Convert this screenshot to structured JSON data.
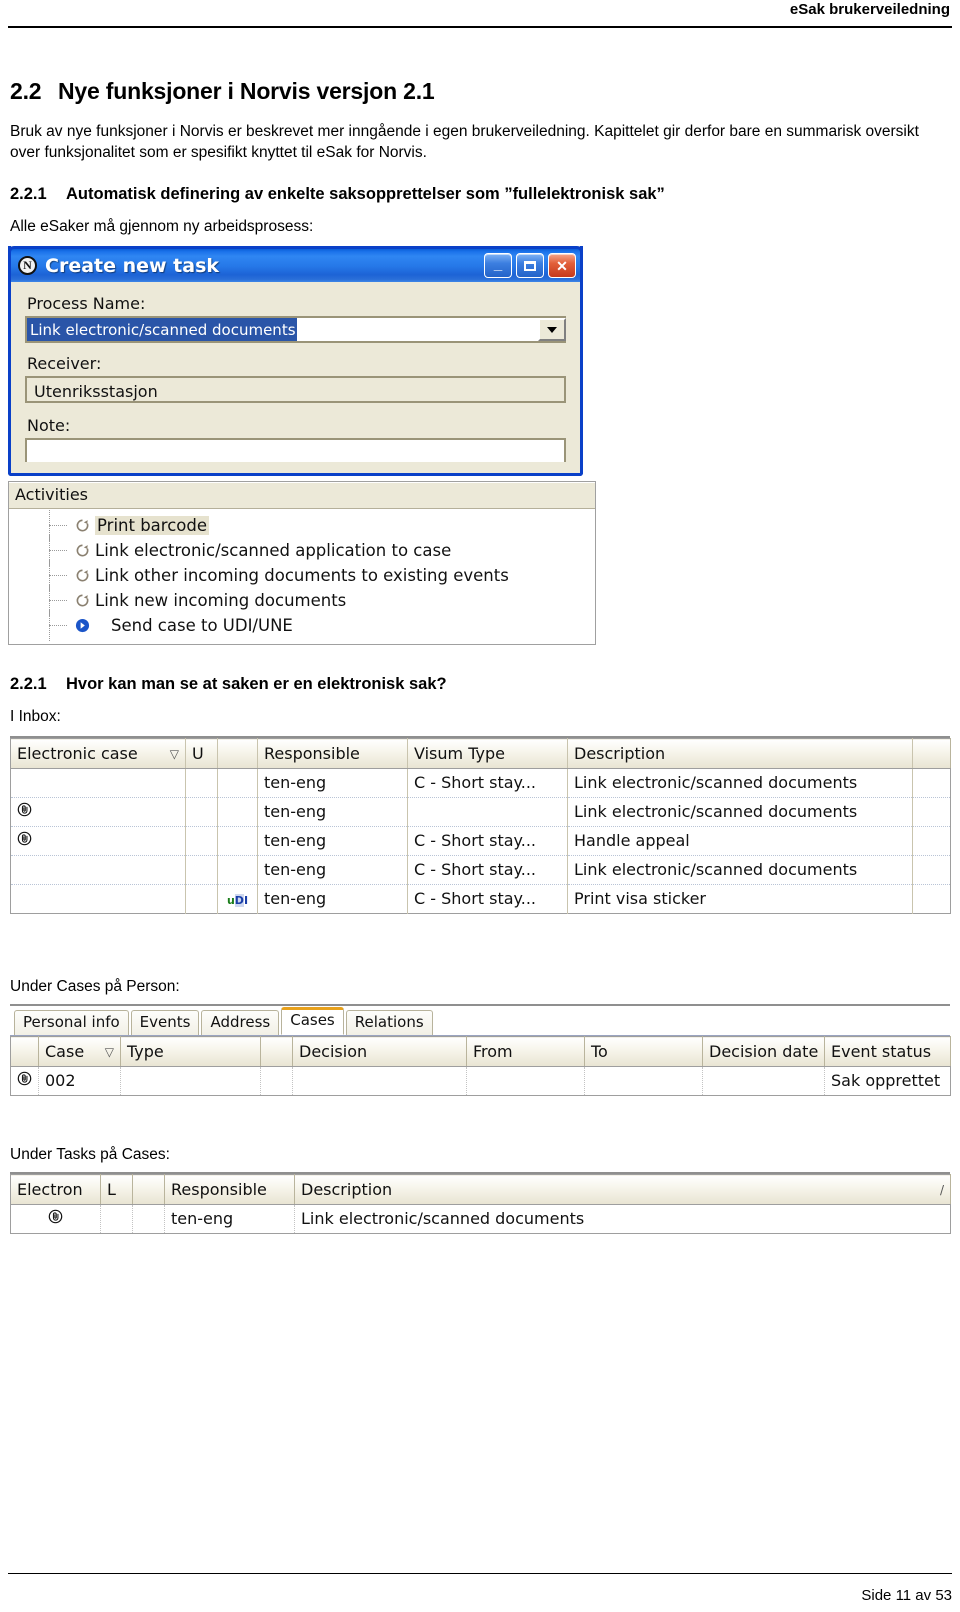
{
  "header": {
    "title": "eSak brukerveiledning"
  },
  "footer": {
    "page_label": "Side 11 av 53"
  },
  "section": {
    "number": "2.2",
    "title": "Nye funksjoner i Norvis versjon 2.1",
    "paragraph": "Bruk av nye funksjoner i Norvis er beskrevet mer inngående i egen brukerveiledning. Kapittelet gir derfor bare en summarisk oversikt over funksjonalitet som er spesifikt knyttet til eSak for Norvis."
  },
  "subsection_1": {
    "number": "2.2.1",
    "title": "Automatisk definering av enkelte saksopprettelser som ”fullelektronisk sak”",
    "lead": "Alle eSaker må gjennom ny arbeidsprosess:"
  },
  "dialog": {
    "title": "Create new task",
    "app_icon_letter": "N",
    "buttons": {
      "minimize": "_",
      "maximize": "□",
      "close": "✕"
    },
    "fields": {
      "process_name_label": "Process Name:",
      "process_name_value": "Link electronic/scanned documents",
      "receiver_label": "Receiver:",
      "receiver_value": "Utenriksstasjon",
      "note_label": "Note:",
      "note_value": ""
    }
  },
  "activities": {
    "header": "Activities",
    "items": [
      {
        "label": "Print barcode",
        "icon": "refresh-icon",
        "highlighted": true
      },
      {
        "label": "Link electronic/scanned application to case",
        "icon": "refresh-icon",
        "highlighted": false
      },
      {
        "label": "Link other incoming documents to existing events",
        "icon": "refresh-icon",
        "highlighted": false
      },
      {
        "label": "Link new incoming documents",
        "icon": "refresh-icon",
        "highlighted": false
      },
      {
        "label": "Send case to UDI/UNE",
        "icon": "blue-arrow-icon",
        "highlighted": false
      }
    ]
  },
  "subsection_2": {
    "number": "2.2.1",
    "title": "Hvor kan man se at saken er en elektronisk sak?",
    "lead": "I Inbox:"
  },
  "inbox_table": {
    "columns": [
      "Electronic case",
      "U",
      "",
      "Responsible",
      "Visum Type",
      "Description",
      ""
    ],
    "sort_column": "Electronic case",
    "rows": [
      {
        "electronic_case": "",
        "u": "",
        "icon": "",
        "responsible": "ten-eng",
        "visum_type": "C - Short stay...",
        "description": "Link electronic/scanned documents"
      },
      {
        "electronic_case": "edoc-icon",
        "u": "",
        "icon": "",
        "responsible": "ten-eng",
        "visum_type": "",
        "description": "Link electronic/scanned documents"
      },
      {
        "electronic_case": "edoc-icon",
        "u": "",
        "icon": "",
        "responsible": "ten-eng",
        "visum_type": "C - Short stay...",
        "description": "Handle appeal"
      },
      {
        "electronic_case": "",
        "u": "",
        "icon": "",
        "responsible": "ten-eng",
        "visum_type": "C - Short stay...",
        "description": "Link electronic/scanned documents"
      },
      {
        "electronic_case": "",
        "u": "",
        "icon": "udi-icon",
        "responsible": "ten-eng",
        "visum_type": "C - Short stay...",
        "description": "Print visa sticker"
      }
    ]
  },
  "person_cases": {
    "caption": "Under Cases på Person:",
    "tabs": [
      {
        "label": "Personal info",
        "active": false
      },
      {
        "label": "Events",
        "active": false
      },
      {
        "label": "Address",
        "active": false
      },
      {
        "label": "Cases",
        "active": true
      },
      {
        "label": "Relations",
        "active": false
      }
    ],
    "columns": [
      "",
      "Case",
      "Type",
      "",
      "Decision",
      "From",
      "To",
      "Decision date",
      "Event status"
    ],
    "sort_column": "Case",
    "rows": [
      {
        "icon": "edoc-icon",
        "case": "002",
        "type": "",
        "blank": "",
        "decision": "",
        "from": "",
        "to": "",
        "decision_date": "",
        "event_status": "Sak opprettet"
      }
    ]
  },
  "case_tasks": {
    "caption": "Under Tasks på Cases:",
    "columns": [
      "Electron",
      "L",
      "",
      "Responsible",
      "Description"
    ],
    "sort_mark": "/",
    "rows": [
      {
        "electron": "edoc-icon",
        "l": "",
        "blank": "",
        "responsible": "ten-eng",
        "description": "Link electronic/scanned documents"
      }
    ]
  },
  "colors": {
    "title_bar_blue": "#1b72ea",
    "dialog_border": "#0a40c8",
    "dialog_face": "#ece9d8",
    "selection_blue": "#2a55a8",
    "active_tab_accent": "#e8a11c",
    "close_button_red": "#c6391c"
  }
}
